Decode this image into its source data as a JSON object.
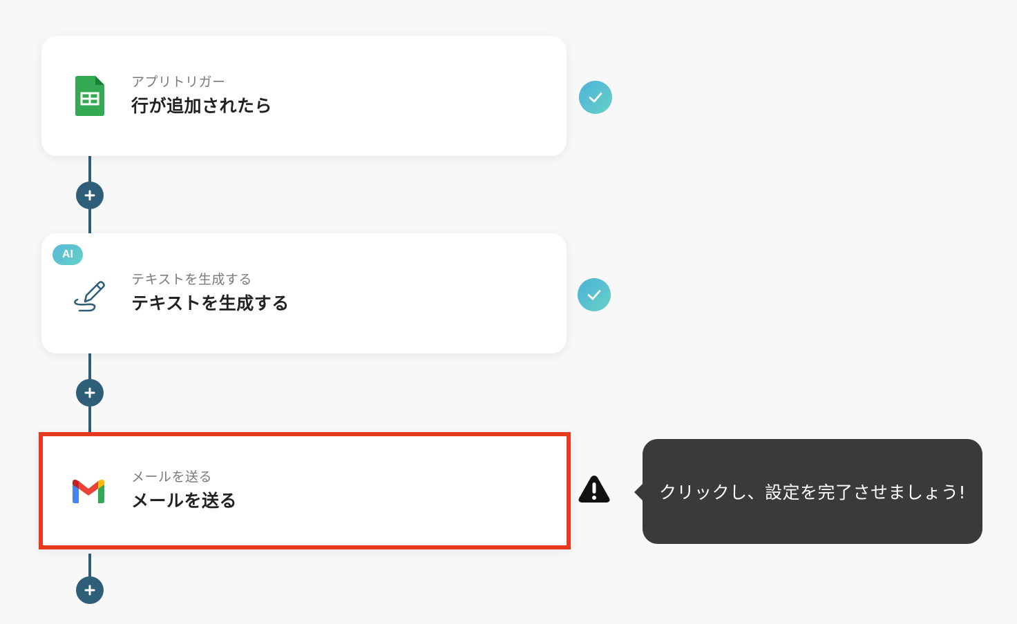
{
  "flow": {
    "steps": [
      {
        "subtitle": "アプリトリガー",
        "title": "行が追加されたら",
        "icon": "google-sheets-icon",
        "status": "complete"
      },
      {
        "badge": "AI",
        "subtitle": "テキストを生成する",
        "title": "テキストを生成する",
        "icon": "pen-line-icon",
        "status": "complete"
      },
      {
        "subtitle": "メールを送る",
        "title": "メールを送る",
        "icon": "gmail-icon",
        "status": "warning",
        "highlighted": true
      }
    ],
    "add_step_icon": "plus-icon"
  },
  "tooltip": {
    "text": "クリックし、設定を完了させましょう!"
  },
  "colors": {
    "background": "#f8f8f9",
    "connector": "#2f5f78",
    "check_gradient_start": "#4cb2d9",
    "check_gradient_end": "#66d1c6",
    "highlight_border": "#e8391f",
    "tooltip_bg": "#3a3a3a",
    "warning": "#111111"
  }
}
